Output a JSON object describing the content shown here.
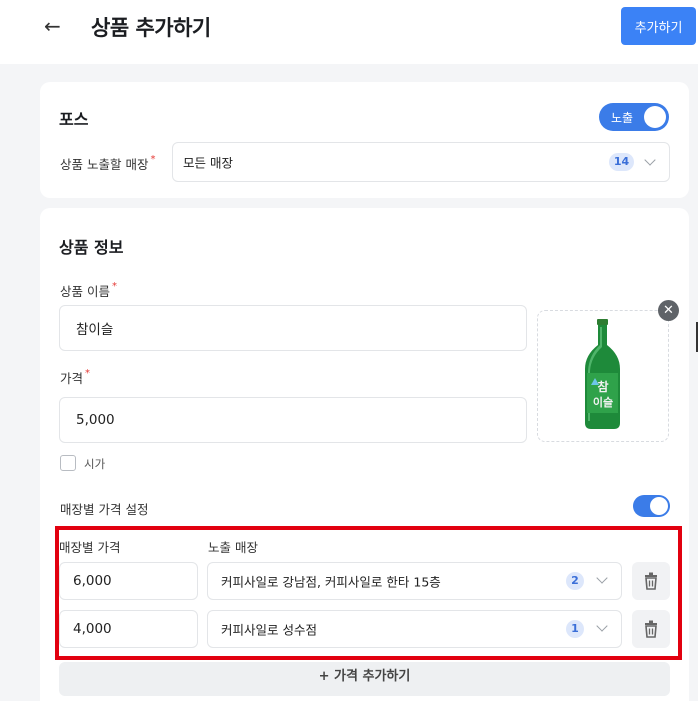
{
  "header": {
    "title": "상품 추가하기",
    "add_button": "추가하기"
  },
  "pos": {
    "title": "포스",
    "toggle_label": "노출",
    "toggle_on": true,
    "store_label": "상품 노출할 매장",
    "store_value": "모든 매장",
    "store_count": "14"
  },
  "product": {
    "title": "상품 정보",
    "name_label": "상품 이름",
    "name_value": "참이슬",
    "price_label": "가격",
    "price_value": "5,000",
    "market_price_label": "시가",
    "store_price_label": "매장별 가격 설정",
    "store_price_on": true,
    "columns": {
      "price": "매장별 가격",
      "stores": "노출 매장"
    },
    "rows": [
      {
        "price": "6,000",
        "stores": "커피사일로 강남점, 커피사일로 한타 15층",
        "count": "2"
      },
      {
        "price": "4,000",
        "stores": "커피사일로 성수점",
        "count": "1"
      }
    ],
    "add_price": "+ 가격 추가하기"
  },
  "colors": {
    "accent": "#3b82f6",
    "toggle": "#3b7ce8",
    "badge_bg": "#dde7fb",
    "highlight": "#e2000f"
  },
  "icons": [
    "back-arrow-icon",
    "chevron-down-icon",
    "close-icon",
    "trash-icon",
    "plus-icon",
    "soju-bottle-image"
  ]
}
